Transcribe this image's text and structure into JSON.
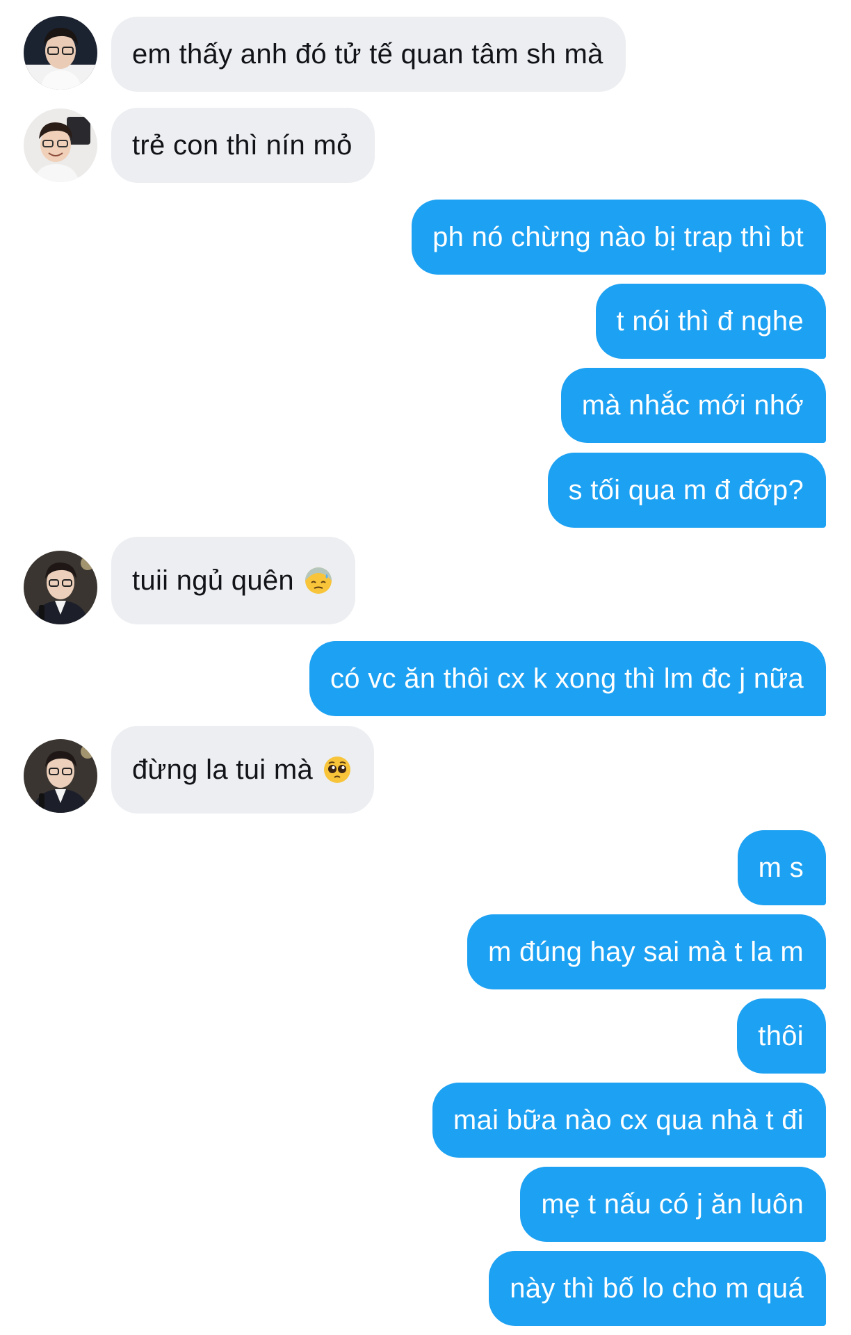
{
  "messages": [
    {
      "side": "in",
      "text": "em thấy anh đó tử tế quan tâm sh mà",
      "avatar": "avatar-glasses-dark-bg"
    },
    {
      "side": "in",
      "text": "trẻ con thì nín mỏ",
      "avatar": "avatar-smiling-studio"
    },
    {
      "side": "out",
      "text": "ph nó chừng nào bị trap thì bt"
    },
    {
      "side": "out",
      "text": "t nói thì đ nghe"
    },
    {
      "side": "out",
      "text": "mà nhắc mới nhớ"
    },
    {
      "side": "out",
      "text": "s tối qua m đ đớp?"
    },
    {
      "side": "in",
      "text": "tuii ngủ quên",
      "emoji": "downcast-sweat-emoji",
      "avatar": "avatar-suit-mic"
    },
    {
      "side": "out",
      "text": "có vc ăn thôi cx k xong thì lm đc j nữa"
    },
    {
      "side": "in",
      "text": "đừng la tui mà",
      "emoji": "pleading-face-emoji",
      "avatar": "avatar-suit-mic"
    },
    {
      "side": "out",
      "text": "m s"
    },
    {
      "side": "out",
      "text": "m đúng hay sai mà t la m"
    },
    {
      "side": "out",
      "text": "thôi"
    },
    {
      "side": "out",
      "text": "mai bữa nào cx qua nhà t đi"
    },
    {
      "side": "out",
      "text": "mẹ t nấu có j ăn luôn"
    },
    {
      "side": "out",
      "text": "này thì bố lo cho m quá"
    }
  ],
  "colors": {
    "outgoing_bubble": "#1da1f2",
    "incoming_bubble": "#eceef1",
    "outgoing_text": "#ffffff",
    "incoming_text": "#111318"
  }
}
